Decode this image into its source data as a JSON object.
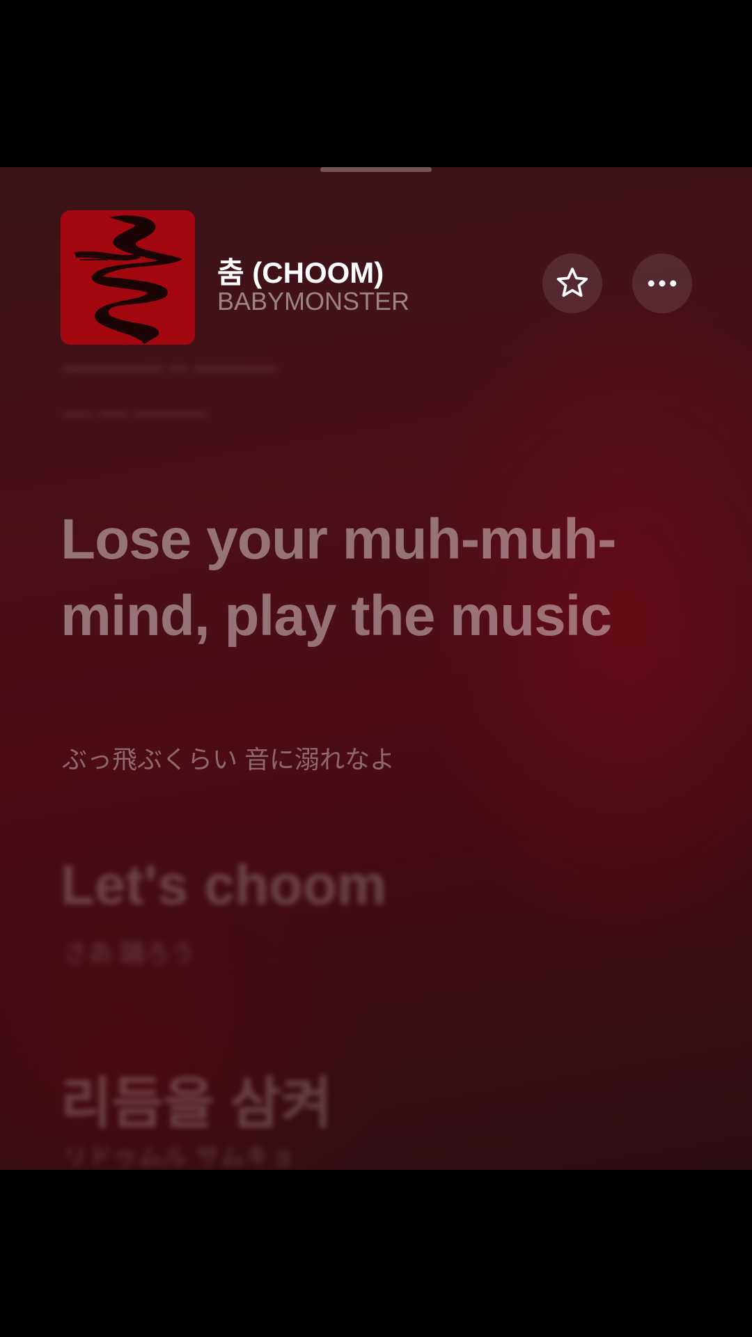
{
  "now_playing": {
    "title": "춤 (CHOOM)",
    "artist": "BABYMONSTER",
    "artwork_icon": "album-artwork",
    "favorite_icon": "star-outline-icon",
    "more_icon": "ellipsis-icon"
  },
  "lyrics": {
    "active_line": "Lose your muh-muh-mind, play the music",
    "active_translation": "ぶっ飛ぶくらい 音に溺れなよ",
    "next_line": "Let's choom",
    "next_translation": "さあ 踊ろう",
    "later_line": "리듬을 삼켜",
    "later_translation": "リドゥムル サムキョ"
  },
  "colors": {
    "background": "#4a0f18",
    "artwork": "#a3070f",
    "text": "#ffffff"
  }
}
